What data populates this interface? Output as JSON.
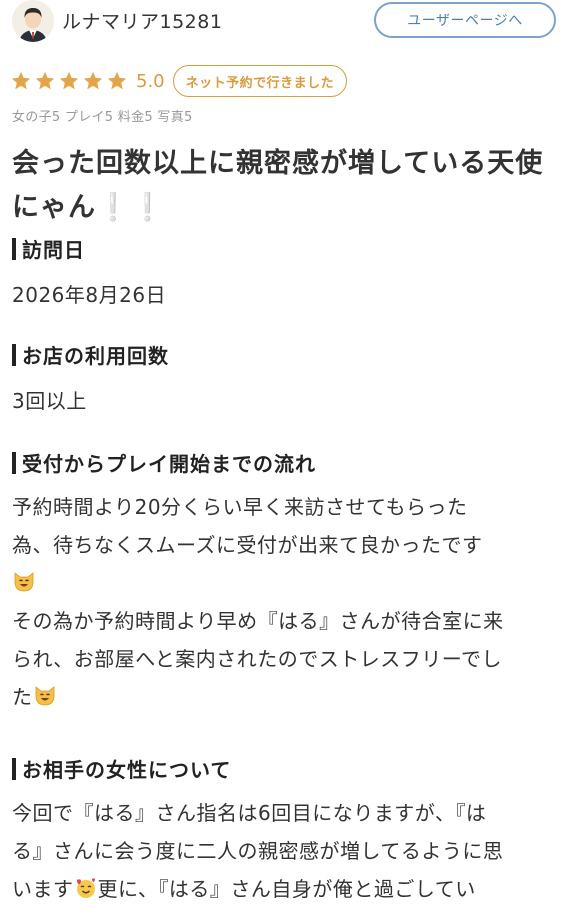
{
  "reviewer": {
    "name": "ルナマリア15281",
    "user_page_button": "ユーザーページへ",
    "avatar_icon": "person-avatar-icon"
  },
  "rating": {
    "stars": 5,
    "max_stars": 5,
    "score": "5.0",
    "visit_badge": "ネット予約で行きました",
    "sub_ratings": "女の子5 プレイ5 料金5 写真5",
    "accent_color": "#d99b3e"
  },
  "review": {
    "title": "会った回数以上に親密感が増している天使にゃん",
    "title_suffix": "❕❕",
    "sections": [
      {
        "heading": "訪問日",
        "body": [
          "2026年8月26日"
        ]
      },
      {
        "heading": "お店の利用回数",
        "body": [
          "3回以上"
        ]
      },
      {
        "heading": "受付からプレイ開始までの流れ",
        "body": [
          "予約時間より20分くらい早く来訪させてもらった",
          "為、待ちなくスムーズに受付が出来て良かったです",
          "その為か予約時間より早め『はる』さんが待合室に来",
          "られ、お部屋へと案内されたのでストレスフリーでし",
          "た"
        ]
      },
      {
        "heading": "お相手の女性について",
        "body": [
          "今回で『はる』さん指名は6回目になりますが、『は",
          "る』さんに会う度に二人の親密感が増してるように思",
          "います",
          "更に、『はる』さん自身が俺と過ごしてい"
        ]
      }
    ],
    "emoji_icons": [
      "cat-emoji-icon",
      "smiling-face-with-hearts-icon"
    ]
  }
}
